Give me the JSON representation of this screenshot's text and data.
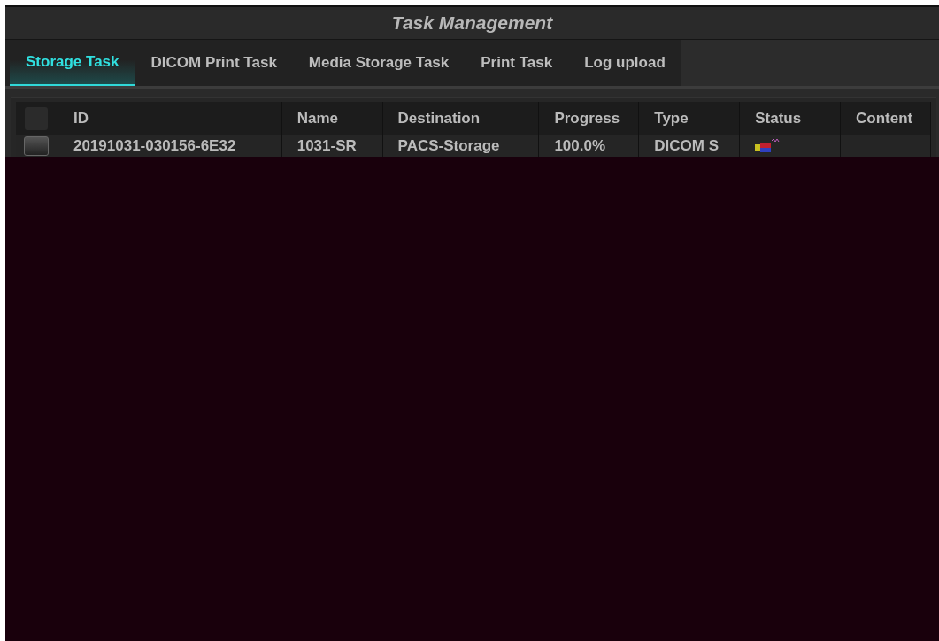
{
  "window": {
    "title": "Task Management"
  },
  "tabs": [
    {
      "label": "Storage Task",
      "selected": true
    },
    {
      "label": "DICOM Print Task",
      "selected": false
    },
    {
      "label": "Media Storage Task",
      "selected": false
    },
    {
      "label": "Print Task",
      "selected": false
    },
    {
      "label": "Log upload",
      "selected": false
    }
  ],
  "table": {
    "select_all_checked": false,
    "columns": [
      "ID",
      "Name",
      "Destination",
      "Progress",
      "Type",
      "Status",
      "Content"
    ],
    "rows": [
      {
        "checked": false,
        "cells": [
          "20191031-030156-6E32",
          "1031-SR",
          "PACS-Storage",
          "100.0%",
          "DICOM S"
        ]
      }
    ]
  }
}
